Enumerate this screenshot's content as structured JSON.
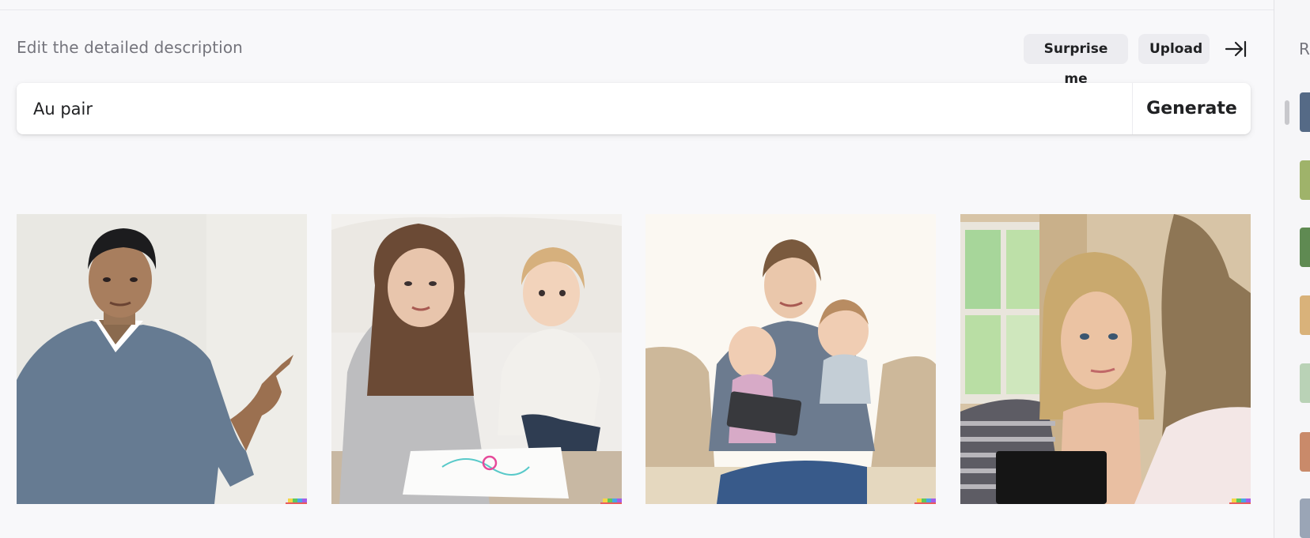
{
  "header": {
    "hint": "Edit the detailed description",
    "surprise_label": "Surprise me",
    "upload_label": "Upload"
  },
  "prompt": {
    "value": "Au pair",
    "generate_label": "Generate"
  },
  "results": [
    {
      "name": "man-pointing-image"
    },
    {
      "name": "woman-with-child-drawing-image"
    },
    {
      "name": "woman-with-babies-tablet-image"
    },
    {
      "name": "two-women-talking-image"
    }
  ],
  "sidebar": {
    "title": "R"
  },
  "colors": {
    "background": "#f8f8fa",
    "button_bg": "#ececf0",
    "text": "#202123",
    "muted_text": "#74747c"
  }
}
